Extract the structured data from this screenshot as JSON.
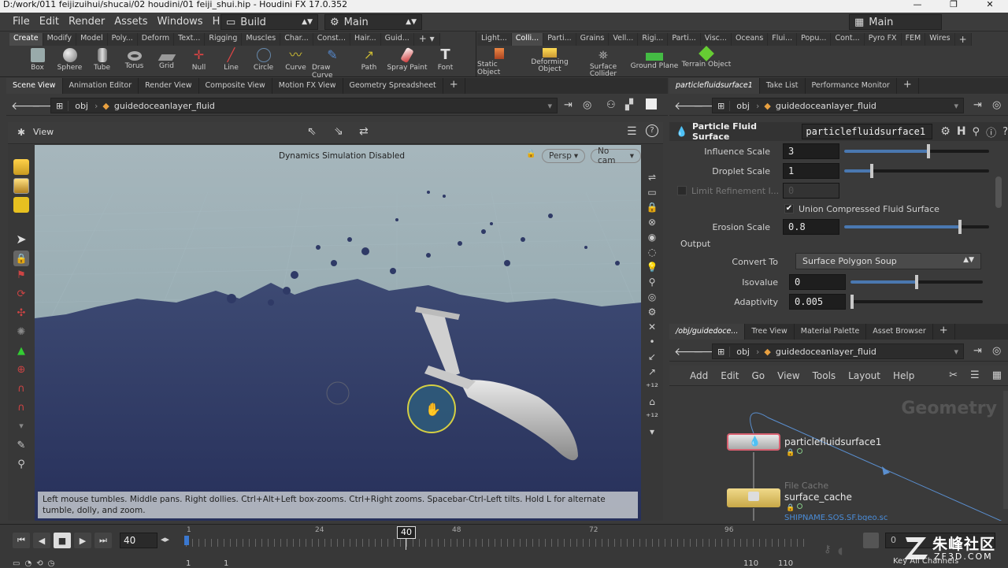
{
  "window": {
    "title": "D:/work/011 feijizuihui/shucai/02 houdini/01 feiji_shui.hip - Houdini FX 17.0.352",
    "controls": [
      "—",
      "❐",
      "✕"
    ]
  },
  "menubar": {
    "items": [
      "File",
      "Edit",
      "Render",
      "Assets",
      "Windows",
      "Help"
    ],
    "desktop_left": "Build",
    "desktop_right": "Main",
    "desktop_far": "Main"
  },
  "shelf_left": {
    "tabs": [
      "Create",
      "Modify",
      "Model",
      "Poly...",
      "Deform",
      "Text...",
      "Rigging",
      "Muscles",
      "Char...",
      "Const...",
      "Hair...",
      "Guid..."
    ],
    "tools": [
      "Box",
      "Sphere",
      "Tube",
      "Torus",
      "Grid",
      "Null",
      "Line",
      "Circle",
      "Curve",
      "Draw Curve",
      "Path",
      "Spray Paint",
      "Font"
    ]
  },
  "shelf_right": {
    "tabs": [
      "Light...",
      "Colli...",
      "Parti...",
      "Grains",
      "Vell...",
      "Rigi...",
      "Parti...",
      "Visc...",
      "Oceans",
      "Flui...",
      "Popu...",
      "Cont...",
      "Pyro FX",
      "FEM",
      "Wires"
    ],
    "tools": [
      "Static Object",
      "Deforming Object",
      "Surface Collider",
      "Ground Plane",
      "Terrain Object"
    ]
  },
  "left_pane": {
    "tabs": [
      "Scene View",
      "Animation Editor",
      "Render View",
      "Composite View",
      "Motion FX View",
      "Geometry Spreadsheet"
    ],
    "path_root": "obj",
    "path_node": "guidedoceanlayer_fluid",
    "view_label": "View",
    "overlay_text": "Dynamics Simulation Disabled",
    "persp": "Persp",
    "cam": "No cam",
    "hint": "Left mouse tumbles. Middle pans. Right dollies. Ctrl+Alt+Left box-zooms. Ctrl+Right zooms. Spacebar-Ctrl-Left tilts. Hold L for alternate tumble, dolly, and zoom."
  },
  "param_pane": {
    "tabs": [
      "particlefluidsurface1",
      "Take List",
      "Performance Monitor"
    ],
    "path_root": "obj",
    "path_node": "guidedoceanlayer_fluid",
    "node_type": "Particle Fluid Surface",
    "node_name": "particlefluidsurface1",
    "params": {
      "influence_label": "Influence Scale",
      "influence_value": "3",
      "influence_fraction": 0.58,
      "droplet_label": "Droplet Scale",
      "droplet_value": "1",
      "droplet_fraction": 0.19,
      "limit_label": "Limit Refinement l...",
      "limit_value": "0",
      "union_label": "Union Compressed Fluid Surface",
      "erosion_label": "Erosion Scale",
      "erosion_value": "0.8",
      "erosion_fraction": 0.8,
      "output_label": "Output",
      "convert_label": "Convert To",
      "convert_value": "Surface Polygon Soup",
      "iso_label": "Isovalue",
      "iso_value": "0",
      "iso_fraction": 0.5,
      "adapt_label": "Adaptivity",
      "adapt_value": "0.005",
      "adapt_fraction": 0.01
    }
  },
  "network_pane": {
    "tabs": [
      "/obj/guidedoce...",
      "Tree View",
      "Material Palette",
      "Asset Browser"
    ],
    "path_root": "obj",
    "path_node": "guidedoceanlayer_fluid",
    "menu": [
      "Add",
      "Edit",
      "Go",
      "View",
      "Tools",
      "Layout",
      "Help"
    ],
    "context_label": "Geometry",
    "nodes": {
      "node1_name": "particlefluidsurface1",
      "node2_type": "File Cache",
      "node2_name": "surface_cache",
      "node2_sub": "SHIPNAME.SOS.SF.bgeo.sc"
    }
  },
  "timeline": {
    "frame": "40",
    "marker": "40",
    "ticks": [
      "1",
      "24",
      "48",
      "72",
      "96"
    ],
    "start": "1",
    "start2": "1",
    "end": "110",
    "end2": "110",
    "key_channels": "Key All Channels"
  },
  "watermark": {
    "main": "朱峰社区",
    "sub": "ZF3D.COM"
  }
}
